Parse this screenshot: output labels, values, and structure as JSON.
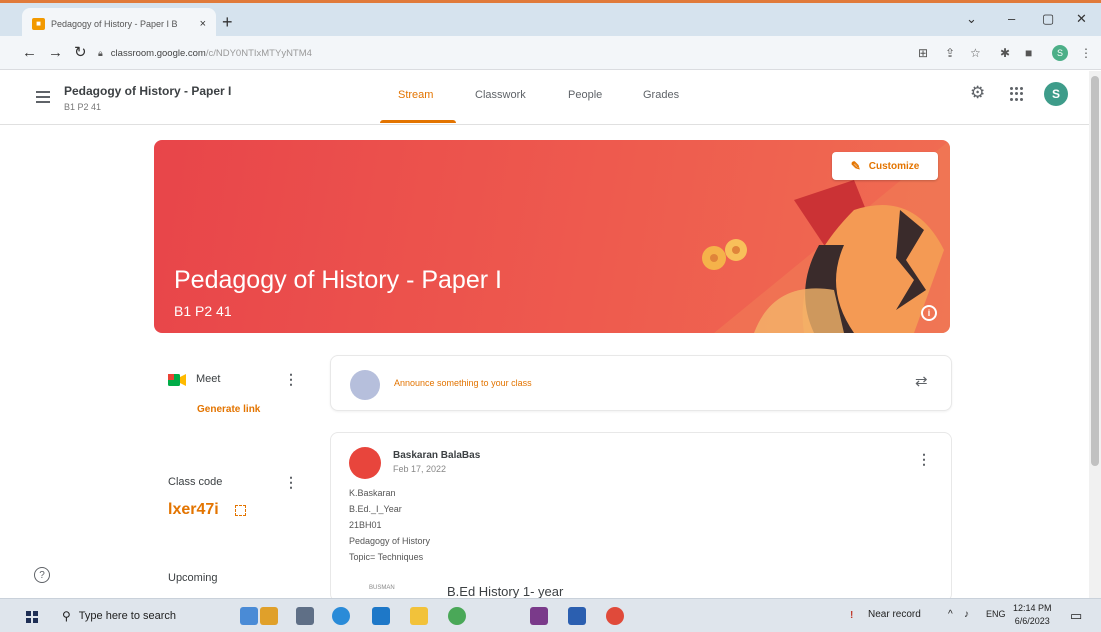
{
  "browser": {
    "tab_title": "Pedagogy of History - Paper I B",
    "tab_close": "×",
    "new_tab": "+",
    "url_host": "classroom.google.com",
    "url_path": "/c/NDY0NTIxMTYyNTM4",
    "minimize": "⌄",
    "maximize": "–",
    "restore": "▢",
    "close": "✕",
    "profile_initial": "S"
  },
  "header": {
    "class_name": "Pedagogy of History - Paper I",
    "class_section": "B1 P2 41",
    "tabs": [
      {
        "label": "Stream"
      },
      {
        "label": "Classwork"
      },
      {
        "label": "People"
      },
      {
        "label": "Grades"
      }
    ],
    "avatar_initial": "S"
  },
  "banner": {
    "title": "Pedagogy of History - Paper I",
    "section": "B1 P2 41",
    "customize_label": "Customize"
  },
  "sidebar": {
    "meet_label": "Meet",
    "generate_link": "Generate link",
    "class_code_label": "Class code",
    "class_code": "lxer47i",
    "upcoming_label": "Upcoming"
  },
  "stream": {
    "announce_placeholder": "Announce something to your class",
    "post": {
      "author": "Baskaran BalaBas",
      "date": "Feb 17, 2022",
      "lines": [
        "K.Baskaran",
        "B.Ed._I_Year",
        "21BH01",
        "Pedagogy of History",
        "Topic= Techniques"
      ],
      "attachment_label": "BUSMAN",
      "attachment_title": "B.Ed History 1- year"
    }
  },
  "taskbar": {
    "search_placeholder": "Type here to search",
    "weather": "Near record",
    "lang": "ENG",
    "time": "12:14 PM",
    "date": "6/6/2023"
  },
  "colors": {
    "accent": "#e37400",
    "banner": "#ee5a4e",
    "chrome_tab_strip": "#d6e3ee"
  }
}
